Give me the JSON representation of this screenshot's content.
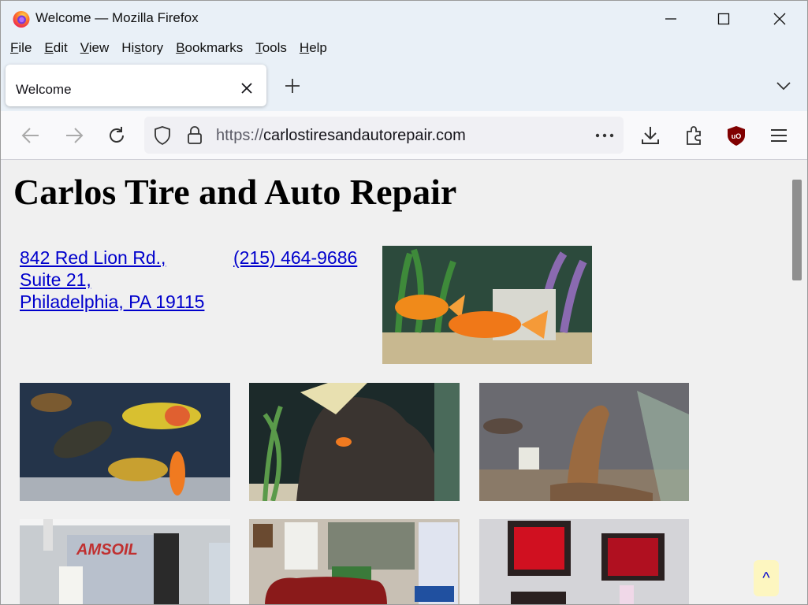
{
  "window": {
    "title": "Welcome — Mozilla Firefox",
    "menu": [
      {
        "pre": "",
        "key": "F",
        "post": "ile"
      },
      {
        "pre": "",
        "key": "E",
        "post": "dit"
      },
      {
        "pre": "",
        "key": "V",
        "post": "iew"
      },
      {
        "pre": "Hi",
        "key": "s",
        "post": "tory"
      },
      {
        "pre": "",
        "key": "B",
        "post": "ookmarks"
      },
      {
        "pre": "",
        "key": "T",
        "post": "ools"
      },
      {
        "pre": "",
        "key": "H",
        "post": "elp"
      }
    ]
  },
  "tab": {
    "label": "Welcome"
  },
  "urlbar": {
    "protocol": "https://",
    "host": "carlostiresandautorepair.com"
  },
  "page": {
    "title": "Carlos Tire and Auto Repair",
    "address_line1": "842 Red Lion Rd.,",
    "address_line2": "Suite 21,",
    "address_line3": "Philadelphia, PA 19115",
    "phone": "(215) 464-9686",
    "back_to_top": "^"
  },
  "colors": {
    "link": "#0000cc",
    "ublock": "#800000"
  }
}
